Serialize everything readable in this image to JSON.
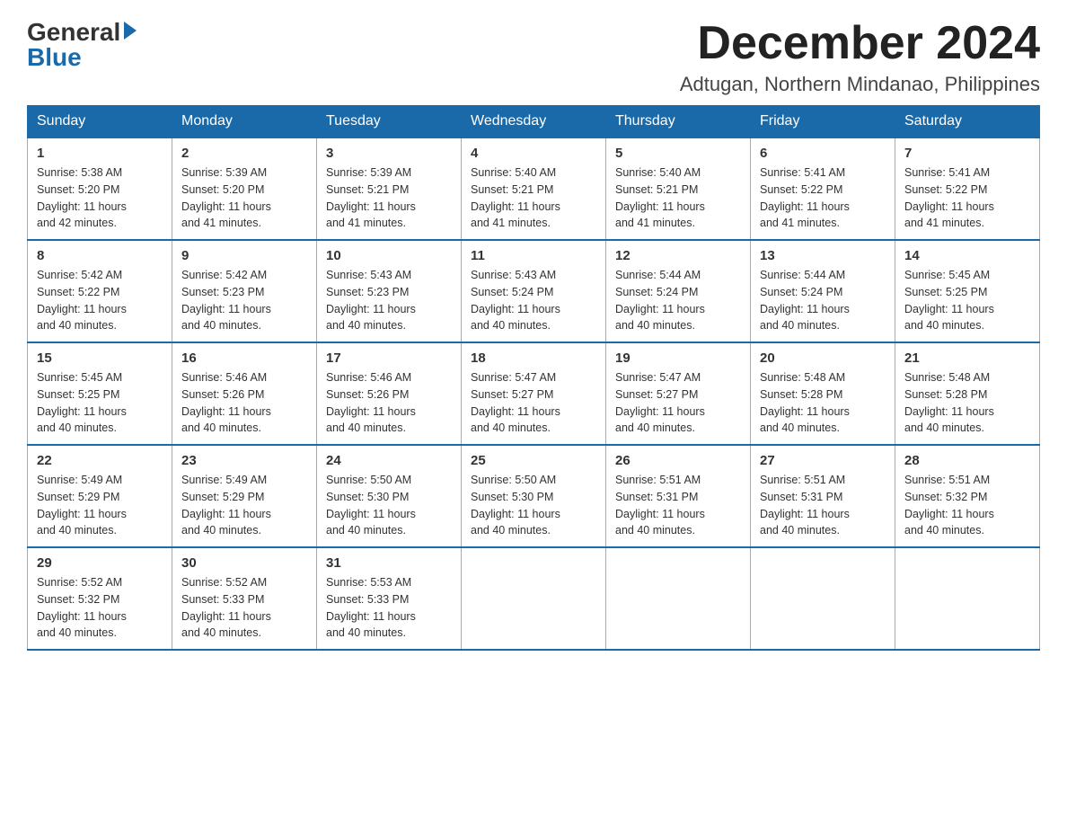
{
  "logo": {
    "general": "General",
    "blue": "Blue"
  },
  "header": {
    "month": "December 2024",
    "location": "Adtugan, Northern Mindanao, Philippines"
  },
  "weekdays": [
    "Sunday",
    "Monday",
    "Tuesday",
    "Wednesday",
    "Thursday",
    "Friday",
    "Saturday"
  ],
  "weeks": [
    [
      {
        "day": "1",
        "sunrise": "5:38 AM",
        "sunset": "5:20 PM",
        "daylight": "11 hours and 42 minutes."
      },
      {
        "day": "2",
        "sunrise": "5:39 AM",
        "sunset": "5:20 PM",
        "daylight": "11 hours and 41 minutes."
      },
      {
        "day": "3",
        "sunrise": "5:39 AM",
        "sunset": "5:21 PM",
        "daylight": "11 hours and 41 minutes."
      },
      {
        "day": "4",
        "sunrise": "5:40 AM",
        "sunset": "5:21 PM",
        "daylight": "11 hours and 41 minutes."
      },
      {
        "day": "5",
        "sunrise": "5:40 AM",
        "sunset": "5:21 PM",
        "daylight": "11 hours and 41 minutes."
      },
      {
        "day": "6",
        "sunrise": "5:41 AM",
        "sunset": "5:22 PM",
        "daylight": "11 hours and 41 minutes."
      },
      {
        "day": "7",
        "sunrise": "5:41 AM",
        "sunset": "5:22 PM",
        "daylight": "11 hours and 41 minutes."
      }
    ],
    [
      {
        "day": "8",
        "sunrise": "5:42 AM",
        "sunset": "5:22 PM",
        "daylight": "11 hours and 40 minutes."
      },
      {
        "day": "9",
        "sunrise": "5:42 AM",
        "sunset": "5:23 PM",
        "daylight": "11 hours and 40 minutes."
      },
      {
        "day": "10",
        "sunrise": "5:43 AM",
        "sunset": "5:23 PM",
        "daylight": "11 hours and 40 minutes."
      },
      {
        "day": "11",
        "sunrise": "5:43 AM",
        "sunset": "5:24 PM",
        "daylight": "11 hours and 40 minutes."
      },
      {
        "day": "12",
        "sunrise": "5:44 AM",
        "sunset": "5:24 PM",
        "daylight": "11 hours and 40 minutes."
      },
      {
        "day": "13",
        "sunrise": "5:44 AM",
        "sunset": "5:24 PM",
        "daylight": "11 hours and 40 minutes."
      },
      {
        "day": "14",
        "sunrise": "5:45 AM",
        "sunset": "5:25 PM",
        "daylight": "11 hours and 40 minutes."
      }
    ],
    [
      {
        "day": "15",
        "sunrise": "5:45 AM",
        "sunset": "5:25 PM",
        "daylight": "11 hours and 40 minutes."
      },
      {
        "day": "16",
        "sunrise": "5:46 AM",
        "sunset": "5:26 PM",
        "daylight": "11 hours and 40 minutes."
      },
      {
        "day": "17",
        "sunrise": "5:46 AM",
        "sunset": "5:26 PM",
        "daylight": "11 hours and 40 minutes."
      },
      {
        "day": "18",
        "sunrise": "5:47 AM",
        "sunset": "5:27 PM",
        "daylight": "11 hours and 40 minutes."
      },
      {
        "day": "19",
        "sunrise": "5:47 AM",
        "sunset": "5:27 PM",
        "daylight": "11 hours and 40 minutes."
      },
      {
        "day": "20",
        "sunrise": "5:48 AM",
        "sunset": "5:28 PM",
        "daylight": "11 hours and 40 minutes."
      },
      {
        "day": "21",
        "sunrise": "5:48 AM",
        "sunset": "5:28 PM",
        "daylight": "11 hours and 40 minutes."
      }
    ],
    [
      {
        "day": "22",
        "sunrise": "5:49 AM",
        "sunset": "5:29 PM",
        "daylight": "11 hours and 40 minutes."
      },
      {
        "day": "23",
        "sunrise": "5:49 AM",
        "sunset": "5:29 PM",
        "daylight": "11 hours and 40 minutes."
      },
      {
        "day": "24",
        "sunrise": "5:50 AM",
        "sunset": "5:30 PM",
        "daylight": "11 hours and 40 minutes."
      },
      {
        "day": "25",
        "sunrise": "5:50 AM",
        "sunset": "5:30 PM",
        "daylight": "11 hours and 40 minutes."
      },
      {
        "day": "26",
        "sunrise": "5:51 AM",
        "sunset": "5:31 PM",
        "daylight": "11 hours and 40 minutes."
      },
      {
        "day": "27",
        "sunrise": "5:51 AM",
        "sunset": "5:31 PM",
        "daylight": "11 hours and 40 minutes."
      },
      {
        "day": "28",
        "sunrise": "5:51 AM",
        "sunset": "5:32 PM",
        "daylight": "11 hours and 40 minutes."
      }
    ],
    [
      {
        "day": "29",
        "sunrise": "5:52 AM",
        "sunset": "5:32 PM",
        "daylight": "11 hours and 40 minutes."
      },
      {
        "day": "30",
        "sunrise": "5:52 AM",
        "sunset": "5:33 PM",
        "daylight": "11 hours and 40 minutes."
      },
      {
        "day": "31",
        "sunrise": "5:53 AM",
        "sunset": "5:33 PM",
        "daylight": "11 hours and 40 minutes."
      },
      null,
      null,
      null,
      null
    ]
  ],
  "labels": {
    "sunrise": "Sunrise:",
    "sunset": "Sunset:",
    "daylight": "Daylight:"
  }
}
